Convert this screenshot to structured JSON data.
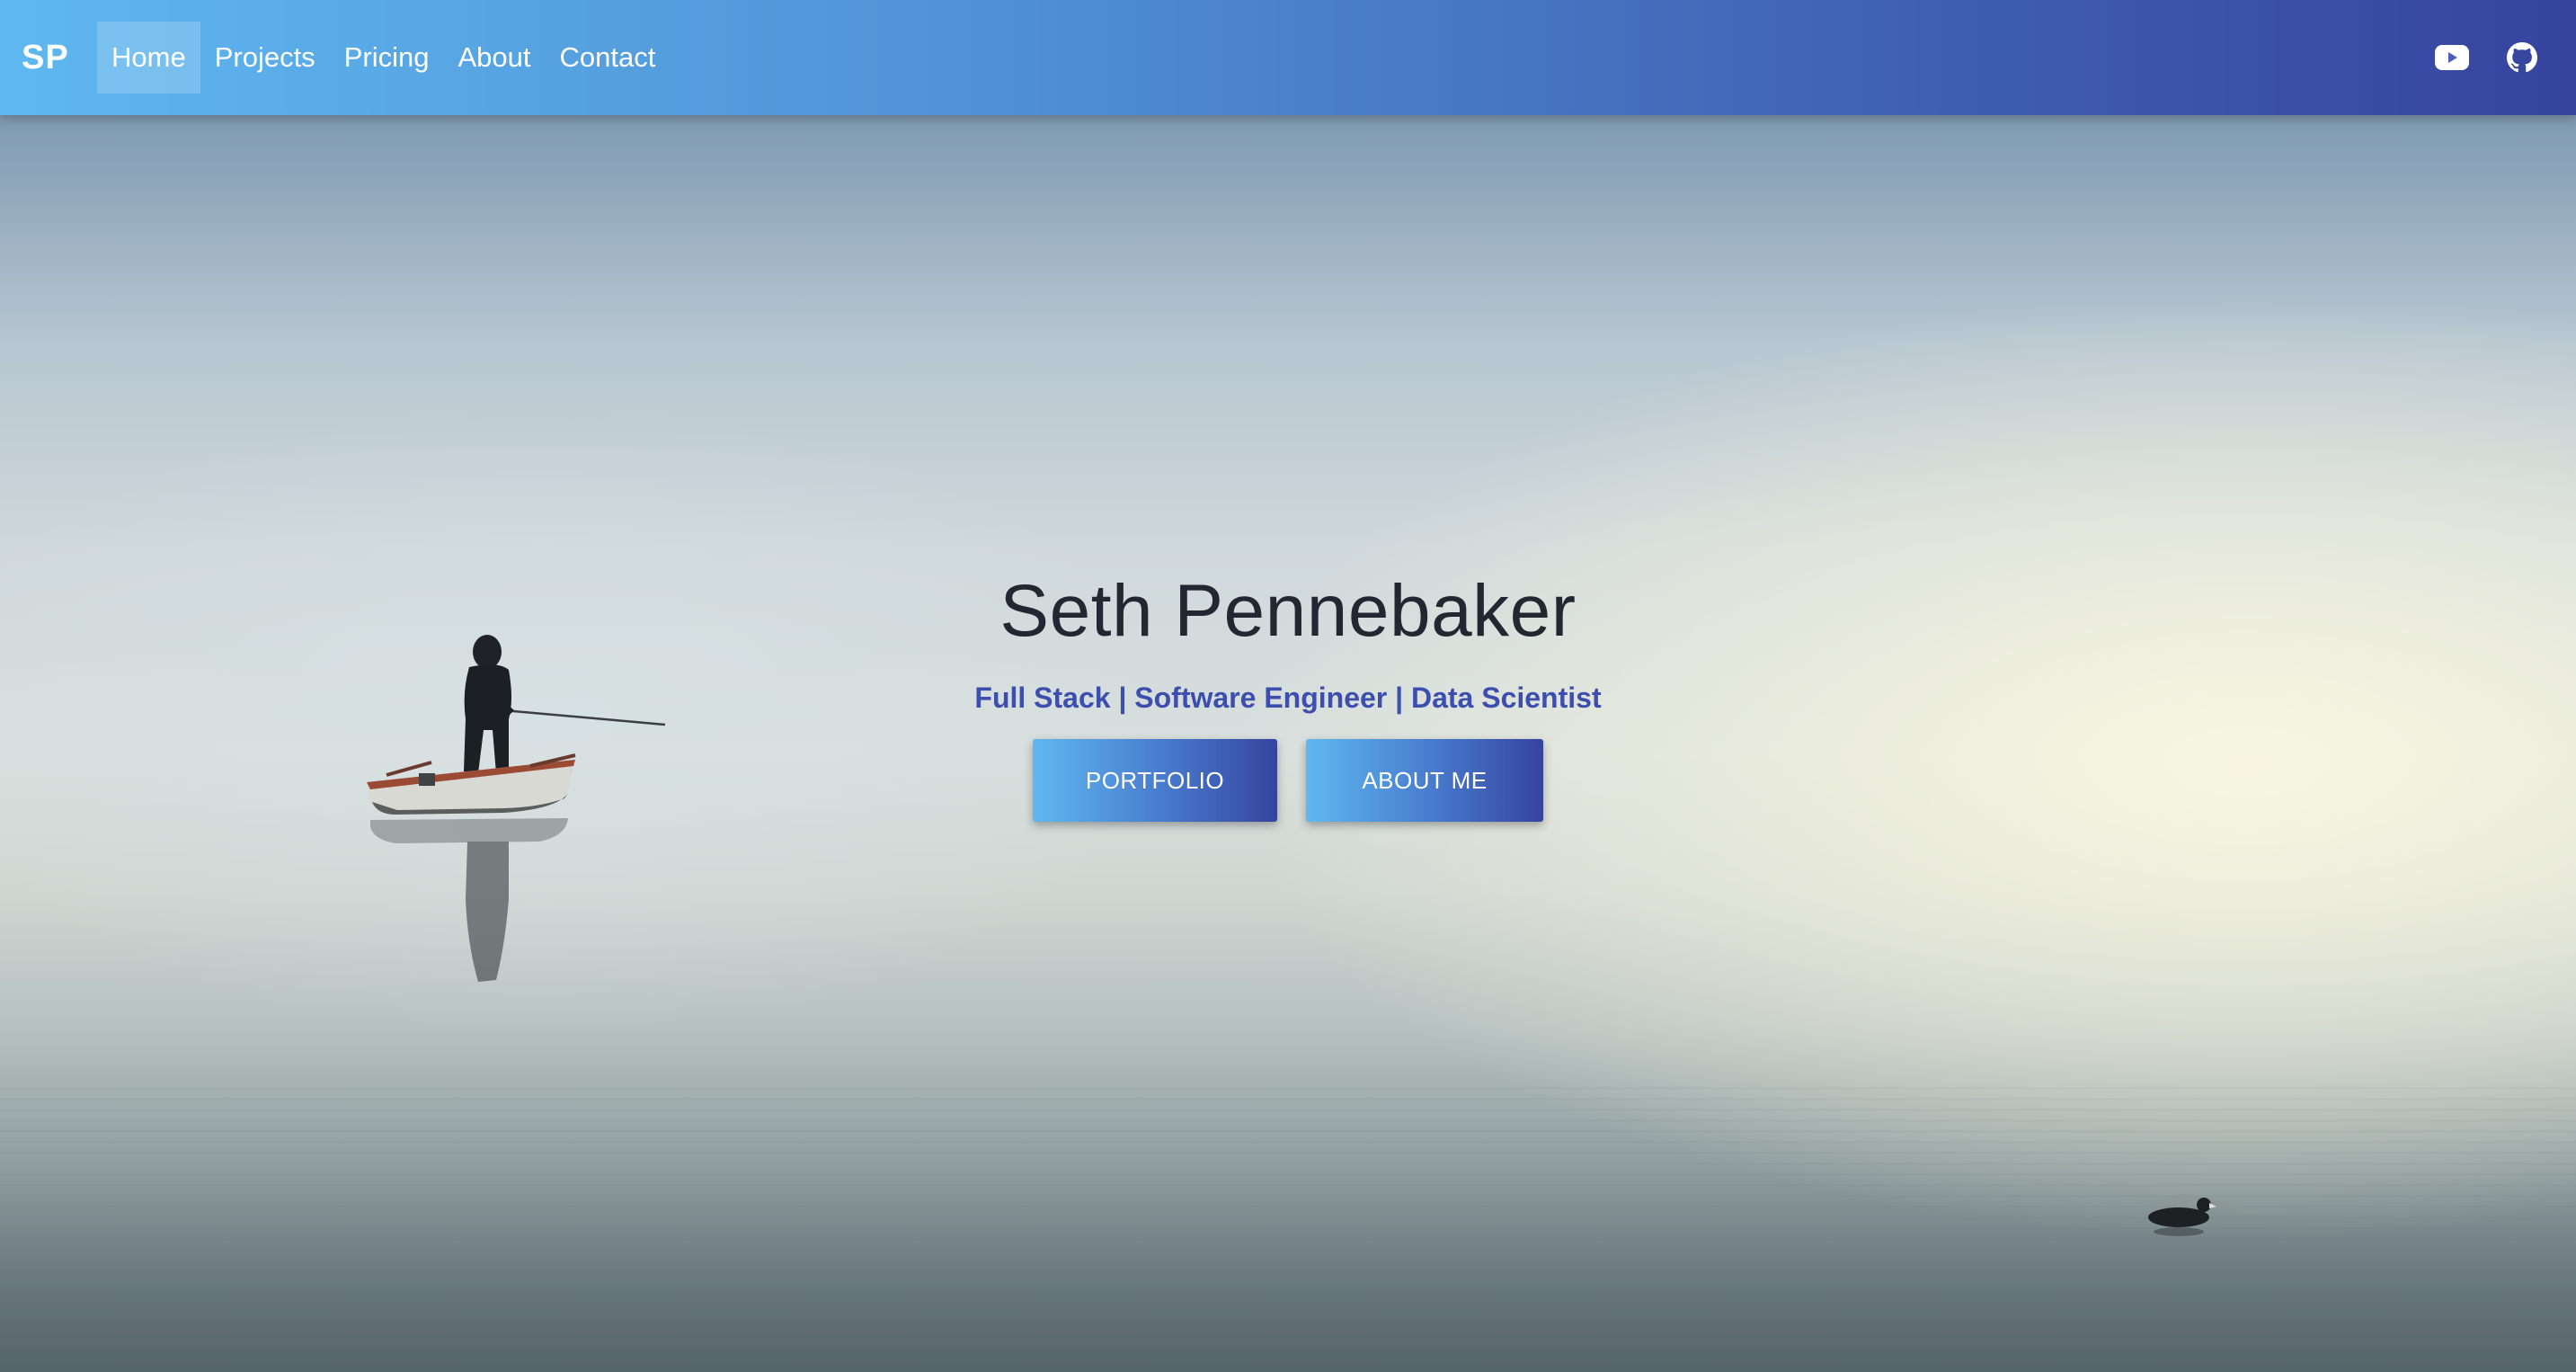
{
  "navbar": {
    "brand": "SP",
    "links": [
      {
        "label": "Home",
        "active": true
      },
      {
        "label": "Projects",
        "active": false
      },
      {
        "label": "Pricing",
        "active": false
      },
      {
        "label": "About",
        "active": false
      },
      {
        "label": "Contact",
        "active": false
      }
    ],
    "icons": [
      "youtube-icon",
      "github-icon"
    ],
    "gradient": [
      "#5fb8f0",
      "#36449f"
    ]
  },
  "hero": {
    "title": "Seth Pennebaker",
    "subtitle": "Full Stack | Software Engineer | Data Scientist",
    "buttons": [
      {
        "label": "PORTFOLIO"
      },
      {
        "label": "ABOUT ME"
      }
    ],
    "subtitle_color": "#3d4fae"
  }
}
